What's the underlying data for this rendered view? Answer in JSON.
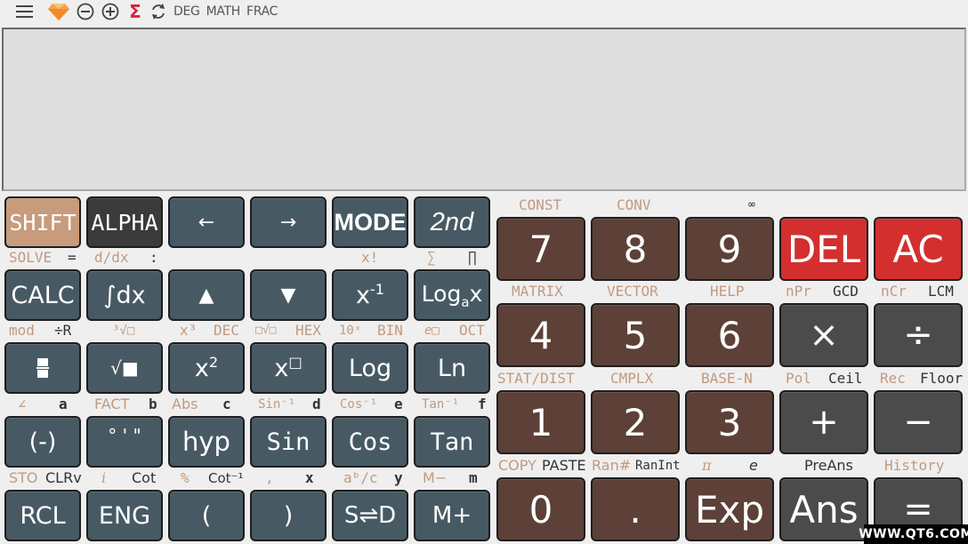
{
  "toolbar": {
    "menu_icon": "menu-icon",
    "premium_icon": "diamond-icon",
    "zoom_out_icon": "minus-circle-icon",
    "zoom_in_icon": "plus-circle-icon",
    "sigma_icon": "sigma-icon",
    "refresh_icon": "rotate-icon",
    "angle_mode": "DEG",
    "input_mode": "MATH",
    "output_mode": "FRAC"
  },
  "display": {
    "expression": "",
    "result": ""
  },
  "colors": {
    "function_key": "#475a64",
    "shift_key": "#c79b7c",
    "alpha_key": "#3b3b3b",
    "number_key": "#5d4037",
    "operator_key": "#4b4b4b",
    "delete_key": "#d32f2f",
    "shift_label": "#c29a7e",
    "alpha_label": "#333333"
  },
  "left_keys": {
    "row1": {
      "shift": "SHIFT",
      "alpha": "ALPHA",
      "left": "←",
      "right": "→",
      "mode": "MODE",
      "second": "2nd"
    },
    "row1_labels": {
      "solve": "SOLVE",
      "eq": "=",
      "ddx": "d/dx",
      "colon": ":",
      "fact": "x!",
      "sum": "∑",
      "prod": "∏"
    },
    "row2": {
      "calc": "CALC",
      "integral": "∫dx",
      "up": "▲",
      "down": "▼",
      "inverse_base": "x",
      "inverse_exp": "-1",
      "loga_base": "Log",
      "loga_sub": "a",
      "loga_arg": "x"
    },
    "row2_labels": {
      "mod": "mod",
      "divr": "÷R",
      "cbrt": "³√□",
      "cube": "x³",
      "dec": "DEC",
      "nroot": "□√□",
      "hex": "HEX",
      "tenx": "10ˣ",
      "bin": "BIN",
      "ex": "e□",
      "oct": "OCT"
    },
    "row3": {
      "fraction": "fraction",
      "sqrt": "√■",
      "square_base": "x",
      "square_exp": "2",
      "power_base": "x",
      "power_exp": "□",
      "log": "Log",
      "ln": "Ln"
    },
    "row3_labels": {
      "angle": "∠",
      "a": "a",
      "fact": "FACT",
      "b": "b",
      "abs": "Abs",
      "c": "c",
      "asin": "Sin⁻¹",
      "d": "d",
      "acos": "Cos⁻¹",
      "e": "e",
      "atan": "Tan⁻¹",
      "f": "f"
    },
    "row4": {
      "neg": "(-)",
      "dms": "° ' \"",
      "hyp": "hyp",
      "sin": "Sin",
      "cos": "Cos",
      "tan": "Tan"
    },
    "row4_labels": {
      "sto": "STO",
      "clrv": "CLRv",
      "i": "i",
      "cot": "Cot",
      "percent": "%",
      "acot": "Cot⁻¹",
      "comma": ",",
      "x": "x",
      "abc": "aᵇ/c",
      "y": "y",
      "mminus": "M−",
      "m": "m"
    },
    "row5": {
      "rcl": "RCL",
      "eng": "ENG",
      "lparen": "(",
      "rparen": ")",
      "sd": "S⇌D",
      "mplus": "M+"
    }
  },
  "right_keys": {
    "row1_labels": {
      "const": "CONST",
      "conv": "CONV",
      "inf": "∞"
    },
    "row1": {
      "seven": "7",
      "eight": "8",
      "nine": "9",
      "del": "DEL",
      "ac": "AC"
    },
    "row2_labels": {
      "matrix": "MATRIX",
      "vector": "VECTOR",
      "help": "HELP",
      "npr": "nPr",
      "gcd": "GCD",
      "ncr": "nCr",
      "lcm": "LCM"
    },
    "row2": {
      "four": "4",
      "five": "5",
      "six": "6",
      "times": "×",
      "divide": "÷"
    },
    "row3_labels": {
      "stat": "STAT/DIST",
      "cmplx": "CMPLX",
      "basen": "BASE-N",
      "pol": "Pol",
      "ceil": "Ceil",
      "rec": "Rec",
      "floor": "Floor"
    },
    "row3": {
      "one": "1",
      "two": "2",
      "three": "3",
      "plus": "+",
      "minus": "−"
    },
    "row4_labels": {
      "copy": "COPY",
      "paste": "PASTE",
      "ran": "Ran#",
      "ranint": "RanInt",
      "pi": "π",
      "e": "e",
      "preans": "PreAns",
      "history": "History"
    },
    "row4": {
      "zero": "0",
      "dot": ".",
      "exp": "Exp",
      "ans": "Ans",
      "equals": "="
    }
  },
  "watermark": "WWW.QT6.COM"
}
